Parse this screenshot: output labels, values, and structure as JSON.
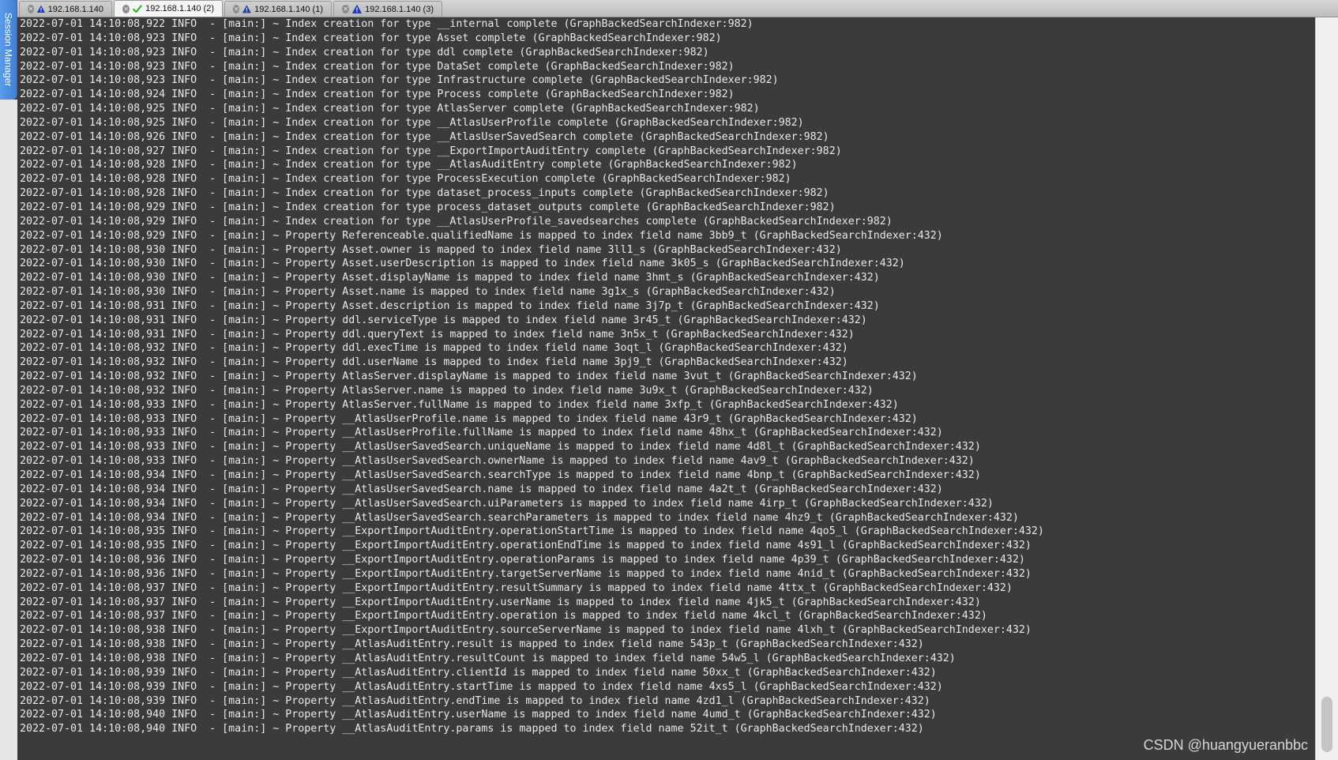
{
  "session_manager": {
    "label": "Session Manager"
  },
  "tabs": [
    {
      "label": "192.168.1.140",
      "status": "warning",
      "active": false
    },
    {
      "label": "192.168.1.140 (2)",
      "status": "connected",
      "active": true
    },
    {
      "label": "192.168.1.140 (1)",
      "status": "warning",
      "active": false
    },
    {
      "label": "192.168.1.140 (3)",
      "status": "warning",
      "active": false
    }
  ],
  "colors": {
    "terminal_bg": "#3b3b3b",
    "terminal_fg": "#e9e9e9",
    "warning": "#1a3cc9",
    "connected": "#2fb52f"
  },
  "terminal": {
    "lines": [
      "2022-07-01 14:10:08,922 INFO  - [main:] ~ Index creation for type __internal complete (GraphBackedSearchIndexer:982)",
      "2022-07-01 14:10:08,923 INFO  - [main:] ~ Index creation for type Asset complete (GraphBackedSearchIndexer:982)",
      "2022-07-01 14:10:08,923 INFO  - [main:] ~ Index creation for type ddl complete (GraphBackedSearchIndexer:982)",
      "2022-07-01 14:10:08,923 INFO  - [main:] ~ Index creation for type DataSet complete (GraphBackedSearchIndexer:982)",
      "2022-07-01 14:10:08,923 INFO  - [main:] ~ Index creation for type Infrastructure complete (GraphBackedSearchIndexer:982)",
      "2022-07-01 14:10:08,924 INFO  - [main:] ~ Index creation for type Process complete (GraphBackedSearchIndexer:982)",
      "2022-07-01 14:10:08,925 INFO  - [main:] ~ Index creation for type AtlasServer complete (GraphBackedSearchIndexer:982)",
      "2022-07-01 14:10:08,925 INFO  - [main:] ~ Index creation for type __AtlasUserProfile complete (GraphBackedSearchIndexer:982)",
      "2022-07-01 14:10:08,926 INFO  - [main:] ~ Index creation for type __AtlasUserSavedSearch complete (GraphBackedSearchIndexer:982)",
      "2022-07-01 14:10:08,927 INFO  - [main:] ~ Index creation for type __ExportImportAuditEntry complete (GraphBackedSearchIndexer:982)",
      "2022-07-01 14:10:08,928 INFO  - [main:] ~ Index creation for type __AtlasAuditEntry complete (GraphBackedSearchIndexer:982)",
      "2022-07-01 14:10:08,928 INFO  - [main:] ~ Index creation for type ProcessExecution complete (GraphBackedSearchIndexer:982)",
      "2022-07-01 14:10:08,928 INFO  - [main:] ~ Index creation for type dataset_process_inputs complete (GraphBackedSearchIndexer:982)",
      "2022-07-01 14:10:08,929 INFO  - [main:] ~ Index creation for type process_dataset_outputs complete (GraphBackedSearchIndexer:982)",
      "2022-07-01 14:10:08,929 INFO  - [main:] ~ Index creation for type __AtlasUserProfile_savedsearches complete (GraphBackedSearchIndexer:982)",
      "2022-07-01 14:10:08,929 INFO  - [main:] ~ Property Referenceable.qualifiedName is mapped to index field name 3bb9_t (GraphBackedSearchIndexer:432)",
      "2022-07-01 14:10:08,930 INFO  - [main:] ~ Property Asset.owner is mapped to index field name 3ll1_s (GraphBackedSearchIndexer:432)",
      "2022-07-01 14:10:08,930 INFO  - [main:] ~ Property Asset.userDescription is mapped to index field name 3k05_s (GraphBackedSearchIndexer:432)",
      "2022-07-01 14:10:08,930 INFO  - [main:] ~ Property Asset.displayName is mapped to index field name 3hmt_s (GraphBackedSearchIndexer:432)",
      "2022-07-01 14:10:08,930 INFO  - [main:] ~ Property Asset.name is mapped to index field name 3g1x_s (GraphBackedSearchIndexer:432)",
      "2022-07-01 14:10:08,931 INFO  - [main:] ~ Property Asset.description is mapped to index field name 3j7p_t (GraphBackedSearchIndexer:432)",
      "2022-07-01 14:10:08,931 INFO  - [main:] ~ Property ddl.serviceType is mapped to index field name 3r45_t (GraphBackedSearchIndexer:432)",
      "2022-07-01 14:10:08,931 INFO  - [main:] ~ Property ddl.queryText is mapped to index field name 3n5x_t (GraphBackedSearchIndexer:432)",
      "2022-07-01 14:10:08,932 INFO  - [main:] ~ Property ddl.execTime is mapped to index field name 3oqt_l (GraphBackedSearchIndexer:432)",
      "2022-07-01 14:10:08,932 INFO  - [main:] ~ Property ddl.userName is mapped to index field name 3pj9_t (GraphBackedSearchIndexer:432)",
      "2022-07-01 14:10:08,932 INFO  - [main:] ~ Property AtlasServer.displayName is mapped to index field name 3vut_t (GraphBackedSearchIndexer:432)",
      "2022-07-01 14:10:08,932 INFO  - [main:] ~ Property AtlasServer.name is mapped to index field name 3u9x_t (GraphBackedSearchIndexer:432)",
      "2022-07-01 14:10:08,933 INFO  - [main:] ~ Property AtlasServer.fullName is mapped to index field name 3xfp_t (GraphBackedSearchIndexer:432)",
      "2022-07-01 14:10:08,933 INFO  - [main:] ~ Property __AtlasUserProfile.name is mapped to index field name 43r9_t (GraphBackedSearchIndexer:432)",
      "2022-07-01 14:10:08,933 INFO  - [main:] ~ Property __AtlasUserProfile.fullName is mapped to index field name 48hx_t (GraphBackedSearchIndexer:432)",
      "2022-07-01 14:10:08,933 INFO  - [main:] ~ Property __AtlasUserSavedSearch.uniqueName is mapped to index field name 4d8l_t (GraphBackedSearchIndexer:432)",
      "2022-07-01 14:10:08,933 INFO  - [main:] ~ Property __AtlasUserSavedSearch.ownerName is mapped to index field name 4av9_t (GraphBackedSearchIndexer:432)",
      "2022-07-01 14:10:08,934 INFO  - [main:] ~ Property __AtlasUserSavedSearch.searchType is mapped to index field name 4bnp_t (GraphBackedSearchIndexer:432)",
      "2022-07-01 14:10:08,934 INFO  - [main:] ~ Property __AtlasUserSavedSearch.name is mapped to index field name 4a2t_t (GraphBackedSearchIndexer:432)",
      "2022-07-01 14:10:08,934 INFO  - [main:] ~ Property __AtlasUserSavedSearch.uiParameters is mapped to index field name 4irp_t (GraphBackedSearchIndexer:432)",
      "2022-07-01 14:10:08,934 INFO  - [main:] ~ Property __AtlasUserSavedSearch.searchParameters is mapped to index field name 4hz9_t (GraphBackedSearchIndexer:432)",
      "2022-07-01 14:10:08,935 INFO  - [main:] ~ Property __ExportImportAuditEntry.operationStartTime is mapped to index field name 4qo5_l (GraphBackedSearchIndexer:432)",
      "2022-07-01 14:10:08,935 INFO  - [main:] ~ Property __ExportImportAuditEntry.operationEndTime is mapped to index field name 4s91_l (GraphBackedSearchIndexer:432)",
      "2022-07-01 14:10:08,936 INFO  - [main:] ~ Property __ExportImportAuditEntry.operationParams is mapped to index field name 4p39_t (GraphBackedSearchIndexer:432)",
      "2022-07-01 14:10:08,936 INFO  - [main:] ~ Property __ExportImportAuditEntry.targetServerName is mapped to index field name 4nid_t (GraphBackedSearchIndexer:432)",
      "2022-07-01 14:10:08,937 INFO  - [main:] ~ Property __ExportImportAuditEntry.resultSummary is mapped to index field name 4ttx_t (GraphBackedSearchIndexer:432)",
      "2022-07-01 14:10:08,937 INFO  - [main:] ~ Property __ExportImportAuditEntry.userName is mapped to index field name 4jk5_t (GraphBackedSearchIndexer:432)",
      "2022-07-01 14:10:08,937 INFO  - [main:] ~ Property __ExportImportAuditEntry.operation is mapped to index field name 4kcl_t (GraphBackedSearchIndexer:432)",
      "2022-07-01 14:10:08,938 INFO  - [main:] ~ Property __ExportImportAuditEntry.sourceServerName is mapped to index field name 4lxh_t (GraphBackedSearchIndexer:432)",
      "2022-07-01 14:10:08,938 INFO  - [main:] ~ Property __AtlasAuditEntry.result is mapped to index field name 543p_t (GraphBackedSearchIndexer:432)",
      "2022-07-01 14:10:08,938 INFO  - [main:] ~ Property __AtlasAuditEntry.resultCount is mapped to index field name 54w5_l (GraphBackedSearchIndexer:432)",
      "2022-07-01 14:10:08,939 INFO  - [main:] ~ Property __AtlasAuditEntry.clientId is mapped to index field name 50xx_t (GraphBackedSearchIndexer:432)",
      "2022-07-01 14:10:08,939 INFO  - [main:] ~ Property __AtlasAuditEntry.startTime is mapped to index field name 4xs5_l (GraphBackedSearchIndexer:432)",
      "2022-07-01 14:10:08,939 INFO  - [main:] ~ Property __AtlasAuditEntry.endTime is mapped to index field name 4zd1_l (GraphBackedSearchIndexer:432)",
      "2022-07-01 14:10:08,940 INFO  - [main:] ~ Property __AtlasAuditEntry.userName is mapped to index field name 4umd_t (GraphBackedSearchIndexer:432)",
      "2022-07-01 14:10:08,940 INFO  - [main:] ~ Property __AtlasAuditEntry.params is mapped to index field name 52it_t (GraphBackedSearchIndexer:432)"
    ]
  },
  "watermark": "CSDN @huangyueranbbc"
}
